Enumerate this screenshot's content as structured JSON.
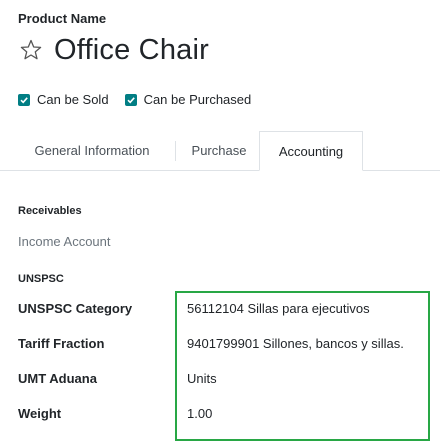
{
  "product": {
    "name_label": "Product Name",
    "name": "Office Chair",
    "favorite_icon": "star-outline-icon"
  },
  "options": {
    "can_be_sold": "Can be Sold",
    "can_be_purchased": "Can be Purchased",
    "can_be_sold_checked": true,
    "can_be_purchased_checked": true
  },
  "tabs": [
    {
      "label": "General Information",
      "active": false
    },
    {
      "label": "Purchase",
      "active": false
    },
    {
      "label": "Accounting",
      "active": true
    }
  ],
  "receivables": {
    "title": "Receivables",
    "income_account_label": "Income Account",
    "income_account_value": ""
  },
  "unspsc": {
    "title": "UNSPSC",
    "rows": [
      {
        "label": "UNSPSC Category",
        "value": "56112104 Sillas para ejecutivos"
      },
      {
        "label": "Tariff Fraction",
        "value": "9401799901 Sillones, bancos y sillas."
      },
      {
        "label": "UMT Aduana",
        "value": "Units"
      },
      {
        "label": "Weight",
        "value": "1.00"
      }
    ]
  },
  "colors": {
    "checkbox": "#017e84",
    "highlight_border": "#28a745",
    "muted_text": "#6c757d"
  }
}
